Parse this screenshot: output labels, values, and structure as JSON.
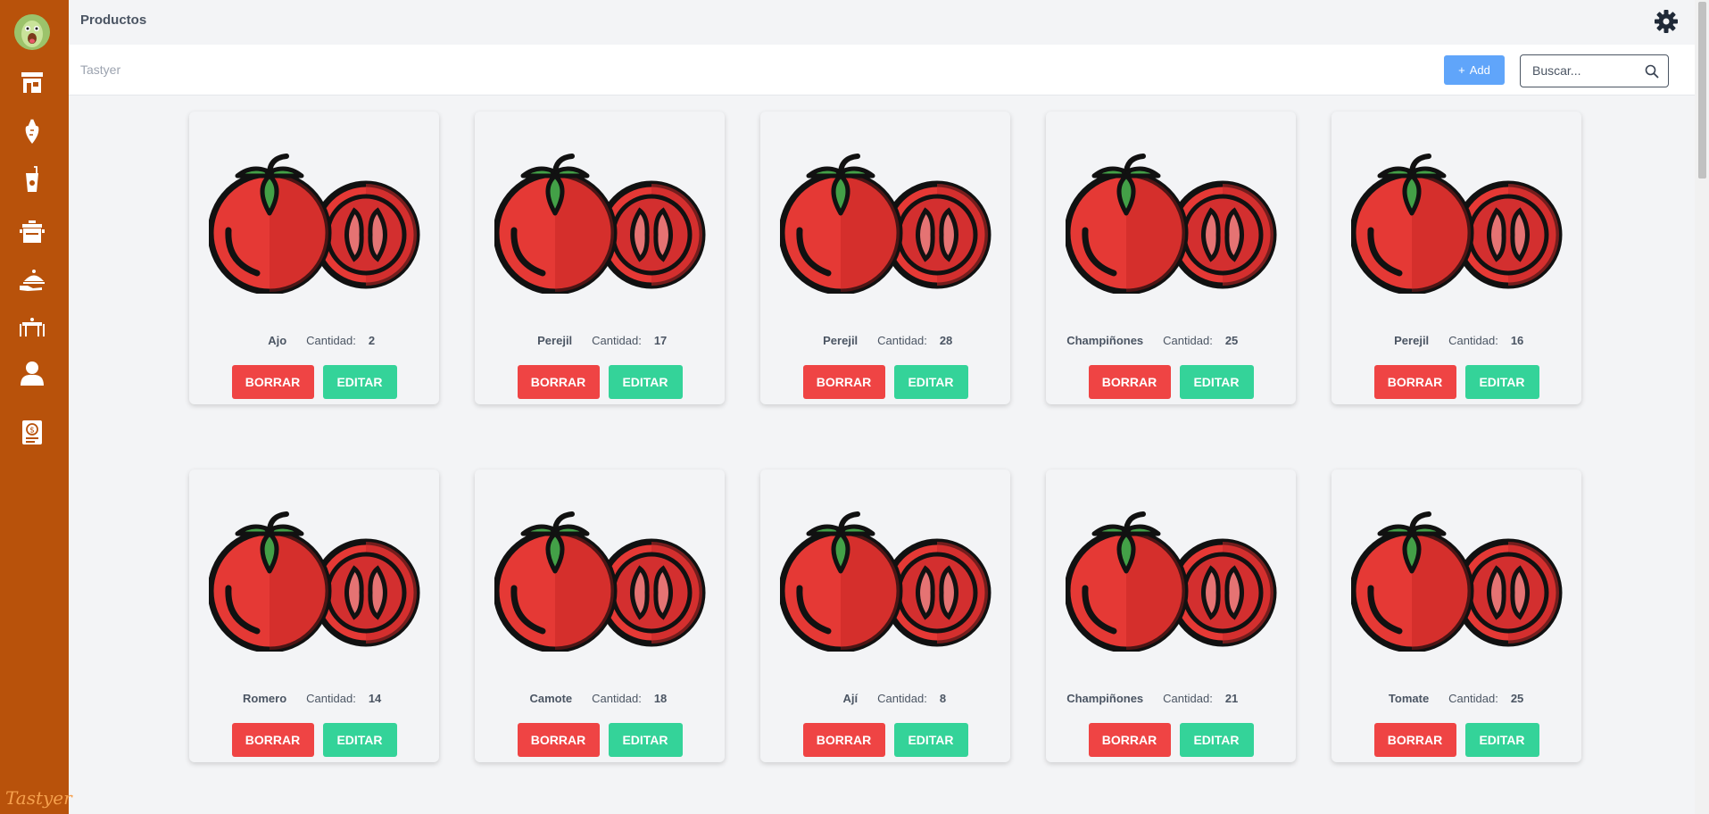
{
  "header": {
    "title": "Productos",
    "settings_icon": "gear-icon"
  },
  "subheader": {
    "breadcrumb": "Tastyer",
    "add_label": "Add",
    "search_placeholder": "Buscar..."
  },
  "sidebar": {
    "brand": "Tastyer",
    "items": [
      {
        "icon": "store-icon"
      },
      {
        "icon": "produce-icon"
      },
      {
        "icon": "drink-icon"
      },
      {
        "icon": "pot-icon"
      },
      {
        "icon": "serving-dish-icon"
      },
      {
        "icon": "table-icon"
      },
      {
        "icon": "user-icon"
      },
      {
        "icon": "invoice-icon"
      }
    ]
  },
  "products": [
    {
      "name": "Ajo",
      "qty_label": "Cantidad:",
      "qty": "2",
      "delete_label": "BORRAR",
      "edit_label": "EDITAR"
    },
    {
      "name": "Perejil",
      "qty_label": "Cantidad:",
      "qty": "17",
      "delete_label": "BORRAR",
      "edit_label": "EDITAR"
    },
    {
      "name": "Perejil",
      "qty_label": "Cantidad:",
      "qty": "28",
      "delete_label": "BORRAR",
      "edit_label": "EDITAR"
    },
    {
      "name": "Champiñones",
      "qty_label": "Cantidad:",
      "qty": "25",
      "delete_label": "BORRAR",
      "edit_label": "EDITAR"
    },
    {
      "name": "Perejil",
      "qty_label": "Cantidad:",
      "qty": "16",
      "delete_label": "BORRAR",
      "edit_label": "EDITAR"
    },
    {
      "name": "Romero",
      "qty_label": "Cantidad:",
      "qty": "14",
      "delete_label": "BORRAR",
      "edit_label": "EDITAR"
    },
    {
      "name": "Camote",
      "qty_label": "Cantidad:",
      "qty": "18",
      "delete_label": "BORRAR",
      "edit_label": "EDITAR"
    },
    {
      "name": "Ají",
      "qty_label": "Cantidad:",
      "qty": "8",
      "delete_label": "BORRAR",
      "edit_label": "EDITAR"
    },
    {
      "name": "Champiñones",
      "qty_label": "Cantidad:",
      "qty": "21",
      "delete_label": "BORRAR",
      "edit_label": "EDITAR"
    },
    {
      "name": "Tomate",
      "qty_label": "Cantidad:",
      "qty": "25",
      "delete_label": "BORRAR",
      "edit_label": "EDITAR"
    }
  ],
  "colors": {
    "sidebar": "#b8520b",
    "delete": "#ef4444",
    "edit": "#34d399",
    "add": "#60a5fa"
  }
}
